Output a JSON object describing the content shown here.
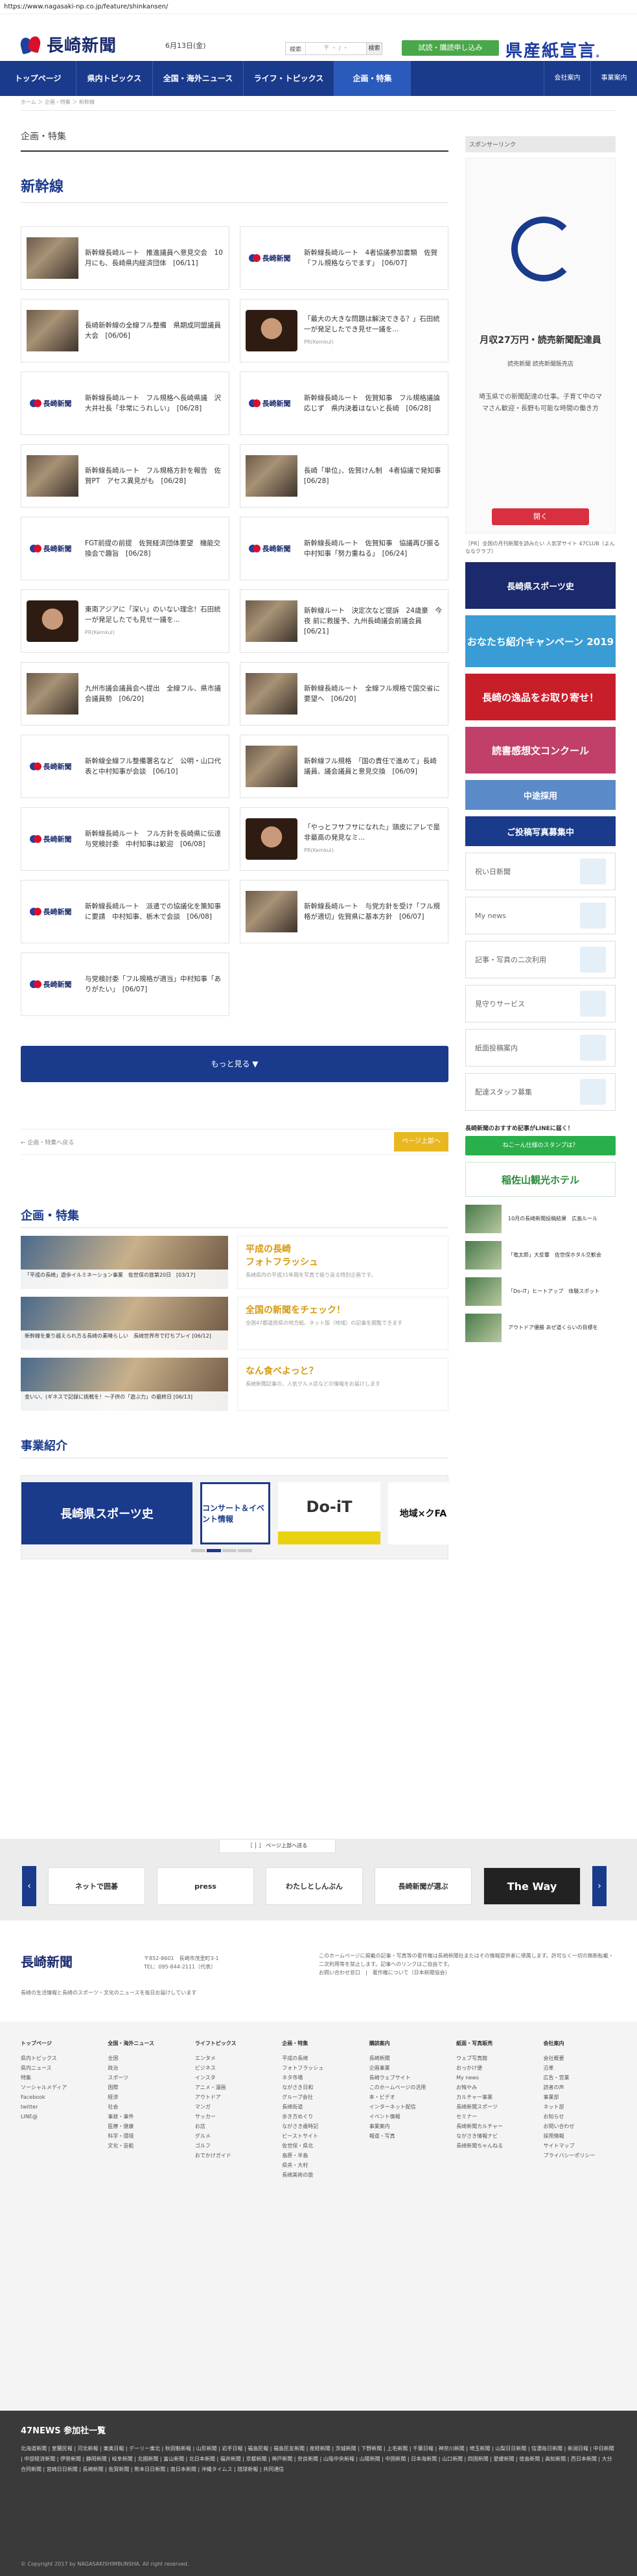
{
  "browser": {
    "url": "https://www.nagasaki-np.co.jp/feature/shinkansen/"
  },
  "header": {
    "logo_text": "長崎新聞",
    "date": "6月13日(金)",
    "search_label": "検索",
    "search_placeholder": "〒 ・ / ・",
    "search_button": "検索",
    "trial_button": "試読・購読申し込み",
    "kenzai_text": "県産紙宣言",
    "kenzai_suffix": "。"
  },
  "nav": {
    "items": [
      "トップページ",
      "県内トピックス",
      "全国・海外ニュース",
      "ライフ・トピックス",
      "企画・特集"
    ],
    "right": [
      "会社案内",
      "事業案内"
    ]
  },
  "breadcrumb": "ホーム ＞ 企画・特集 ＞ 新幹線",
  "main": {
    "section_title": "企画・特集",
    "page_title": "新幹線",
    "cards": [
      {
        "thumb": "photo",
        "text": "新幹線長崎ルート　推進議員へ意見交会　10月にも、長崎県内経済団体　[06/11]"
      },
      {
        "thumb": "logo",
        "text": "新幹線長崎ルート　4者協議参加書類　佐賀「フル規格ならでます」　[06/07]"
      },
      {
        "thumb": "photo",
        "text": "長崎新幹線の全線フル整備　県期成同盟議員大会　[06/06]"
      },
      {
        "thumb": "face",
        "text": "「最大の大きな問題は解決できる？」石田統一が発足したでき見せ一議を...",
        "source": "PR(Kemkul)"
      },
      {
        "thumb": "logo",
        "text": "新幹線長崎ルート　フル規格へ長崎県議　沢大井社長「非常にうれしい」　[06/28]"
      },
      {
        "thumb": "logo",
        "text": "新幹線長崎ルート　佐賀知事　フル規格議論応じず　県内決着はないと長崎　[06/28]"
      },
      {
        "thumb": "photo",
        "text": "新幹線長崎ルート　フル規格方針を報告　佐賀PT　アセス異見がも　[06/28]"
      },
      {
        "thumb": "photo",
        "text": "長崎「単位」、佐賀けん制　4者協議で発知事　[06/28]"
      },
      {
        "thumb": "logo",
        "text": "FGT前提の前提　佐賀経済団体要望　機能交換会で趣旨　[06/28]"
      },
      {
        "thumb": "logo",
        "text": "新幹線長崎ルート　佐賀知事　協議再び振る　中村知事「努力重ねる」　[06/24]"
      },
      {
        "thumb": "face",
        "text": "東南アジアに「深い」のいない理念！石田統一が発足したでも見せ一議を...",
        "source": "PR(Kemkul)"
      },
      {
        "thumb": "photo",
        "text": "新幹線ルート　決定次など提訴　24歳豪　今夜 前に救援予、九州長崎議会前議会員　[06/21]"
      },
      {
        "thumb": "photo",
        "text": "九州市議会議員会へ提出　全線フル、県市議会議員勢　[06/20]"
      },
      {
        "thumb": "photo",
        "text": "新幹線長崎ルート　全線フル規格で国交省に要望へ　[06/20]"
      },
      {
        "thumb": "logo",
        "text": "新幹線全線フル整備署名など　公明・山口代表と中村知事が会談　[06/10]"
      },
      {
        "thumb": "photo",
        "text": "新幹線フル規格　「国の責任で進めて」長崎議員、議会議員と意見交換　[06/09]"
      },
      {
        "thumb": "logo",
        "text": "新幹線長崎ルート　フル方針を長崎県に伝達　与党検討委　中村知事は歓迎　[06/08]"
      },
      {
        "thumb": "face",
        "text": "「やっとフサフサになれた」頭皮にアレで是非最高の発見なミ...",
        "source": "PR(Kemkul)"
      },
      {
        "thumb": "logo",
        "text": "新幹線長崎ルート　派遣での協議化を策知事に要請　中村知事、栃木で会談　[06/08]"
      },
      {
        "thumb": "photo",
        "text": "新幹線長崎ルート　与党方針を受け「フル規格が適切」佐賀県に基本方針　[06/07]"
      },
      {
        "thumb": "logo",
        "text": "与党検討委「フル規格が適当」中村知事「ありがたい」　[06/07]"
      }
    ],
    "more_button": "もっと見る ▼",
    "back_link": "← 企画・特集へ戻る",
    "top_button": "ページ上部へ"
  },
  "features": {
    "title": "企画・特集",
    "items": [
      {
        "caption": "「平成の長崎」遊歩イルミネーション事業　佐世保の旅第20日　[03/17]",
        "title": "平成の長崎\nフォトフラッシュ",
        "desc": "長崎県内の平成31年間を写真で振り返る特別企画です。"
      },
      {
        "caption": "新幹線を乗り越えられ方る長崎の素晴らしい　長崎世界市で打ちプレイ [06/12]",
        "title": "全国の新聞をチェック！",
        "desc": "全国47都道府県の地方紙、ネット版（地域）の記事を閲覧できます"
      },
      {
        "caption": "金いい、(ギネスで記録に挑戦を！～子供の「遊ぶ力」の最終日 [06/13]",
        "title": "なん食べよっと？",
        "desc": "長崎新聞記事の、人気グルメ店などの情報をお届けします"
      }
    ]
  },
  "business": {
    "title": "事業紹介",
    "slides": [
      "長崎県スポーツ史",
      "コンサート＆イベント情報",
      "Do-iT",
      "地域×クFA"
    ]
  },
  "sidebar": {
    "sponsor_label": "スポンサーリンク",
    "ad": {
      "headline": "月収27万円・読売新聞配達員",
      "sub": "読売新聞 読売新聞販売店",
      "body": "埼玉県での新聞配達の仕事。子育て中のママさん歓迎・長野も可能な時間の働き方",
      "button": "開く"
    },
    "note": "［PR］全国の月刊新聞を読みたい 人気学サイト 47CLUB（よんななクラブ）",
    "banners": [
      "長崎県スポーツ史",
      "おなたち紹介キャンペーン 2019",
      "長崎の逸品をお取り寄せ！",
      "読書感想文コンクール",
      "中途採用",
      "ご投稿写真募集中"
    ],
    "links": [
      "祝い日新聞",
      "My news",
      "記事・写真の二次利用",
      "見守りサービス",
      "紙面投稿案内",
      "配達スタッフ募集"
    ],
    "line_label": "長崎新聞のおすすめ記事がLINEに届く！",
    "line_button": "ねこーん仕様のスタンプは？",
    "hotel": "稲佐山観光ホテル",
    "minis": [
      "10月の長崎新聞投稿結果　広島ルール",
      "「竜太郎」大反響　佐世保ホタル交歓会",
      "「Do-iT」ヒートアップ　体験スポット",
      "アウトドア優勝 あぜ道くらいの目標を"
    ]
  },
  "bottom_band": {
    "control": "［ │ ］ ページ上部へ送る",
    "banners": [
      "ネットで囲碁",
      "press",
      "わたしとしんぶん",
      "長崎新聞が選ぶ",
      "The Way"
    ]
  },
  "footer": {
    "logo_text": "長崎新聞",
    "address": "〒852-8601　長崎市茂里町3-1\nTEL：095-844-2111（代表）",
    "note": "このホームページに掲載の記事・写真等の著作権は長崎新聞社またはその情報提供者に帰属します。許可なく一切の無断転載・二次利用等を禁止します。記事へのリンクはご自由です。",
    "privacy": "お問い合わせ窓口　|　著作権について（日本新聞協会）",
    "tagline": "長崎の生活情報と長崎のスポーツ・文化のニュースを毎日お届けしています"
  },
  "footer_cols": [
    {
      "head": "トップページ",
      "items": [
        "県内トピックス",
        "県内ニュース",
        "特集",
        "ソーシャルメディア",
        "Facebook",
        "twitter",
        "LINE@"
      ]
    },
    {
      "head": "全国・海外ニュース",
      "items": [
        "全国",
        "政治",
        "スポーツ",
        "国際",
        "経済",
        "社会",
        "事故・事件",
        "医療・健康",
        "科学・環境",
        "文化・芸能"
      ]
    },
    {
      "head": "ライフトピックス",
      "items": [
        "エンタメ",
        "ビジネス",
        "インスタ",
        "アニメ・漫画",
        "アウトドア",
        "マンガ",
        "サッカー",
        "お店",
        "グルメ",
        "ゴルフ",
        "おでかけガイド"
      ]
    },
    {
      "head": "企画・特集",
      "items": [
        "平成の長崎",
        "フォトフラッシュ",
        "ネタ市場",
        "ながさき日和",
        "グループ会社",
        "長崎街道",
        "歩き方めぐり",
        "ながさき歳時記",
        "ビーストサイト",
        "佐世保・県北",
        "島原・半島",
        "県央・大村",
        "長崎美術の旅"
      ]
    },
    {
      "head": "購読案内",
      "items": [
        "長崎新聞",
        "企画事業",
        "長崎ウェブサイト",
        "このホームページの活用",
        "本・ビデオ",
        "インターネット配信",
        "イベント情報",
        "事業案内",
        "報道・写真"
      ]
    },
    {
      "head": "紙面・写真販売",
      "items": [
        "ウェブ写真館",
        "おっかけ便",
        "My news",
        "お悔やみ",
        "カルチャー事業",
        "長崎新聞スポーツ",
        "セミナー",
        "長崎新聞カルチャー",
        "ながさき情報ナビ",
        "長崎新聞ちゃんねる"
      ]
    },
    {
      "head": "会社案内",
      "items": [
        "会社概要",
        "沿革",
        "広告・営業",
        "読者の声",
        "事業部",
        "ネット部",
        "お知らせ",
        "お問い合わせ",
        "採用情報",
        "サイトマップ",
        "プライバシーポリシー"
      ]
    }
  ],
  "news47": {
    "title": "47NEWS 参加社一覧",
    "list": "北海道新聞 | 室蘭民報 | 河北新報 | 東奥日報 | デーリー東北 | 秋田魁新報 | 山形新聞 | 岩手日報 | 福島民報 | 福島民友新聞 | 産経新聞 | 茨城新聞 | 下野新聞 | 上毛新聞 | 千葉日報 | 神奈川新聞 | 埼玉新聞 | 山梨日日新聞 | 信濃毎日新聞 | 新潟日報 | 中日新聞 | 中部経済新聞 | 伊勢新聞 | 静岡新聞 | 岐阜新聞 | 北國新聞 | 富山新聞 | 北日本新聞 | 福井新聞 | 京都新聞 | 神戸新聞 | 奈良新聞 | 山陰中央新報 | 山陽新聞 | 中国新聞 | 日本海新聞 | 山口新聞 | 四国新聞 | 愛媛新聞 | 徳島新聞 | 高知新聞 | 西日本新聞 | 大分合同新聞 | 宮崎日日新聞 | 長崎新聞 | 佐賀新聞 | 熊本日日新聞 | 南日本新聞 | 沖縄タイムス | 琉球新報 | 共同通信",
    "copyright": "© Copyright 2017 by NAGASAKISHIMBUNSHA.  All right reserved."
  }
}
